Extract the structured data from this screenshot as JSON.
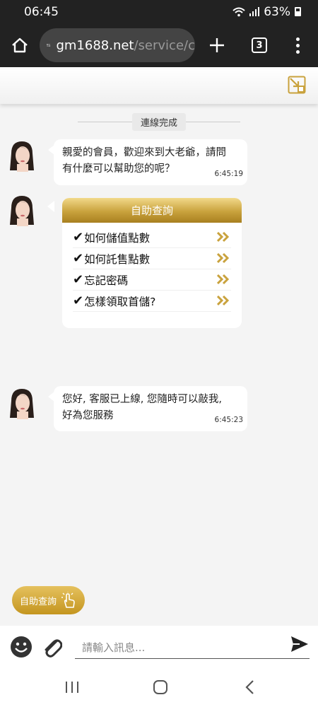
{
  "status_bar": {
    "time": "06:45",
    "battery": "63%"
  },
  "browser": {
    "url_domain": "gm1688.net",
    "url_path": "/service/c",
    "tab_count": "3"
  },
  "chat": {
    "system_notice": "連線完成",
    "messages": [
      {
        "text_line1": "親愛的會員，歡迎來到大老爺，請問",
        "text_line2": "有什麼可以幫助您的呢？",
        "time": "6:45:19"
      },
      {
        "text_line1": "您好, 客服已上線, 您隨時可以敲我,",
        "text_line2": "好為您服務",
        "time": "6:45:23"
      }
    ],
    "self_service_card": {
      "title": "自助查詢",
      "items": [
        {
          "label": "如何儲值點數"
        },
        {
          "label": "如何託售點數"
        },
        {
          "label": "忘記密碼"
        },
        {
          "label": "怎樣領取首儲?"
        }
      ]
    }
  },
  "footer": {
    "self_service_button": "自助查詢",
    "input_placeholder": "請輸入訊息..."
  },
  "colors": {
    "gold": "#c9a23d",
    "dark_bar": "#222222"
  }
}
